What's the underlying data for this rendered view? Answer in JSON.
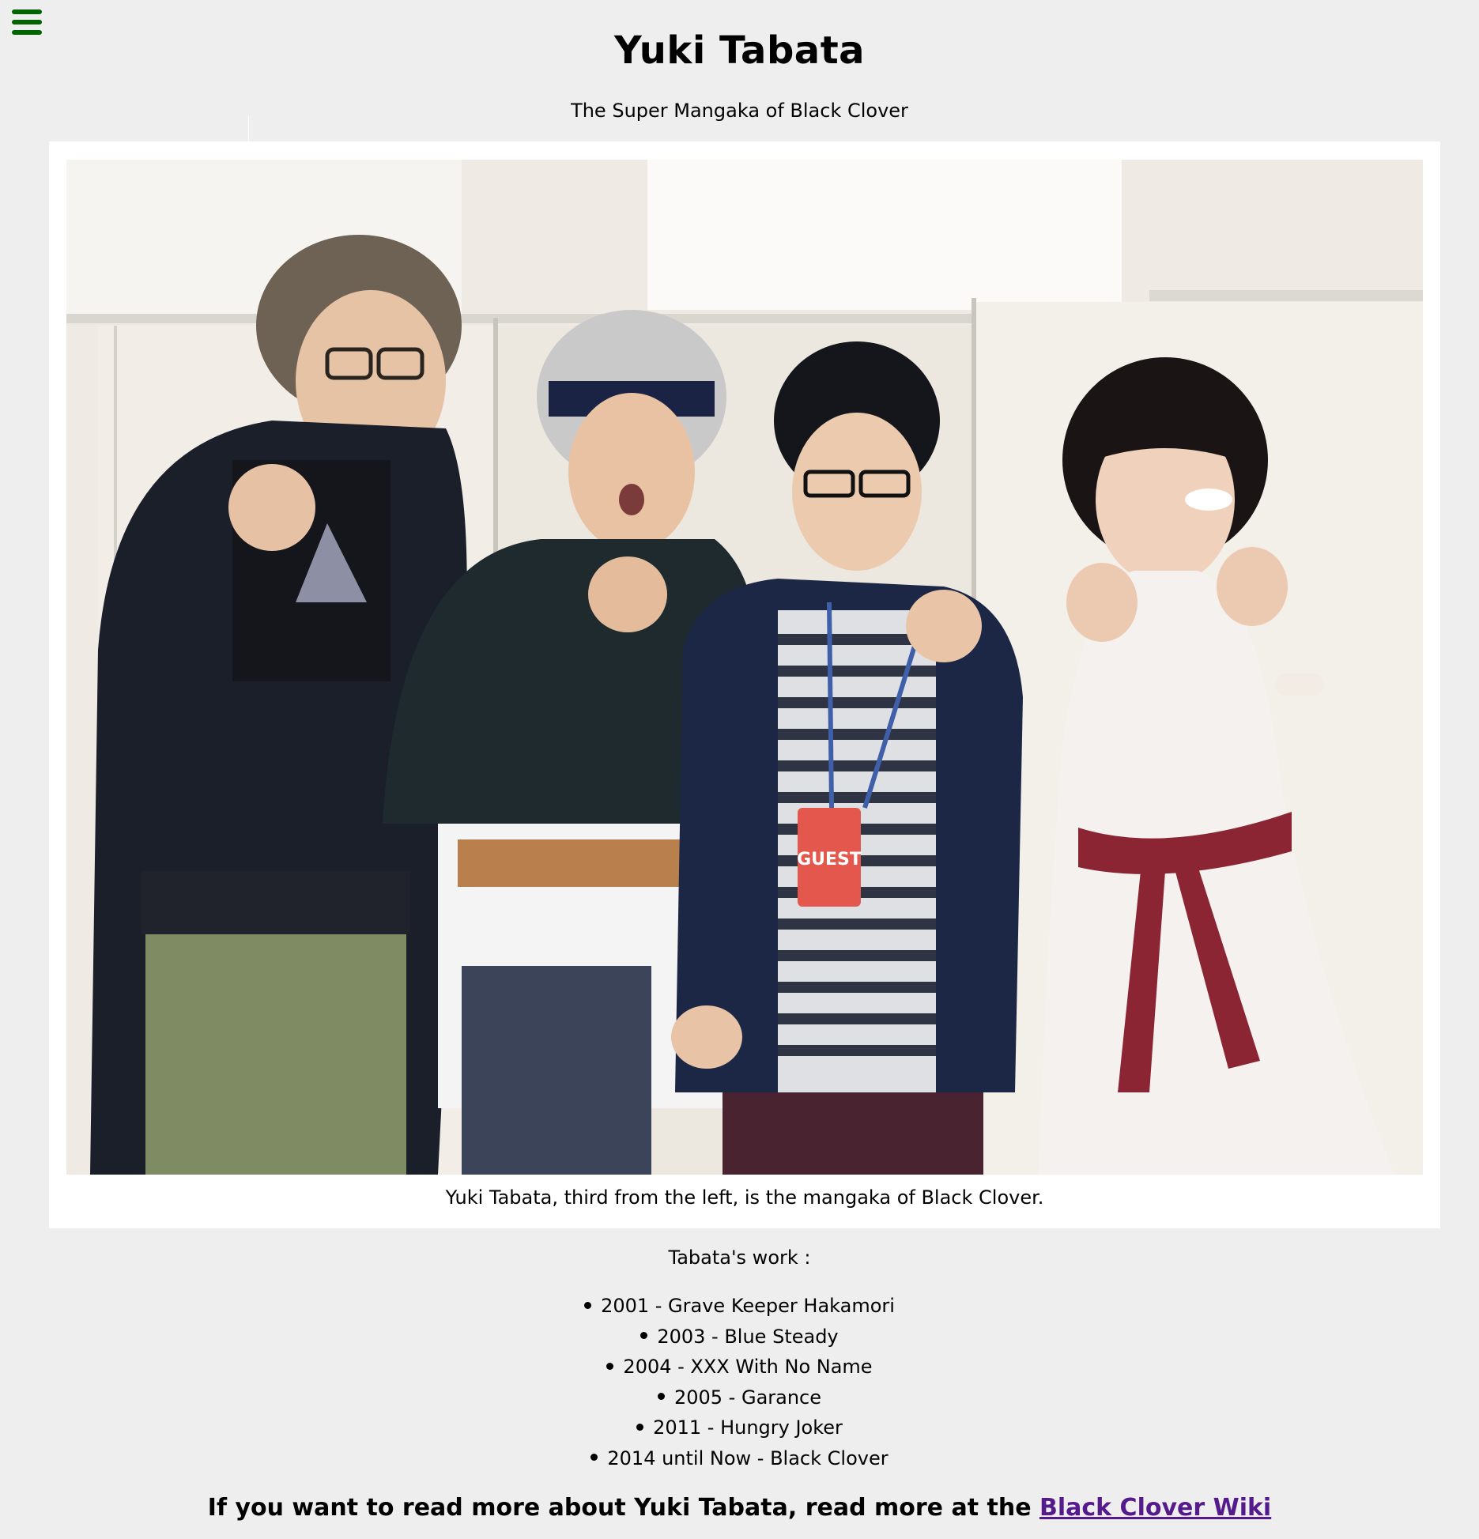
{
  "header": {
    "title": "Yuki Tabata",
    "subtitle": "The Super Mangaka of Black Clover",
    "menu_icon": "hamburger-menu-icon"
  },
  "photo": {
    "caption": "Yuki Tabata, third from the left, is the mangaka of Black Clover.",
    "badge_text": "GUEST"
  },
  "works": {
    "heading": "Tabata's work :",
    "items": [
      "2001 - Grave Keeper Hakamori",
      "2003 - Blue Steady",
      "2004 - XXX With No Name",
      "2005 - Garance",
      "2011 - Hungry Joker",
      "2014 until Now - Black Clover"
    ]
  },
  "footer": {
    "text": "If you want to read more about Yuki Tabata, read more at the ",
    "link_label": "Black Clover Wiki"
  },
  "colors": {
    "background": "#eeeeee",
    "menu_icon": "#006400",
    "link_visited": "#551a8b",
    "card": "#ffffff"
  }
}
